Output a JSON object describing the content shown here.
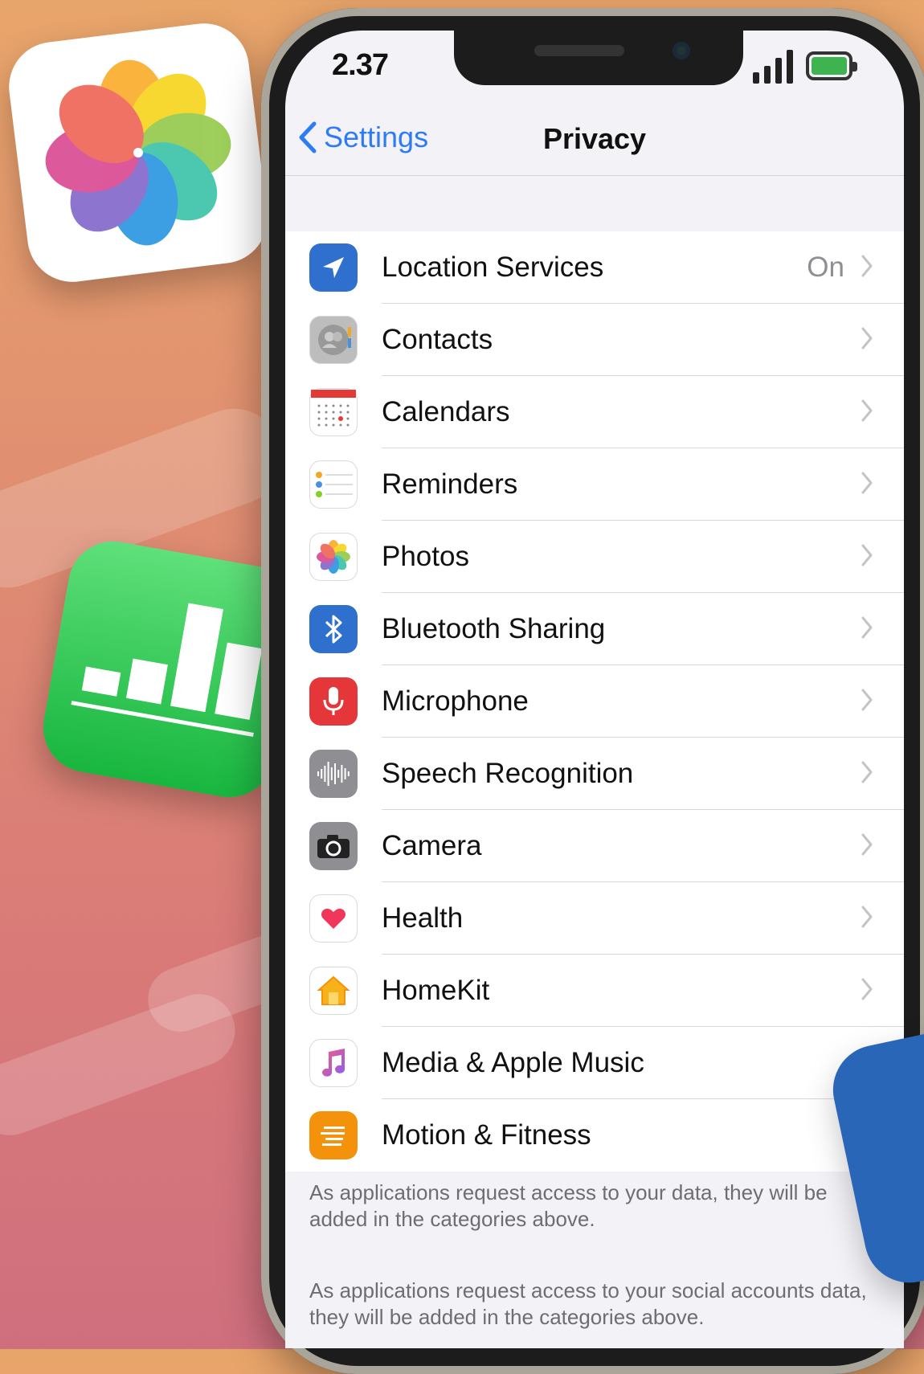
{
  "status_bar": {
    "time": "2.37"
  },
  "nav": {
    "back_label": "Settings",
    "title": "Privacy"
  },
  "rows": [
    {
      "label": "Location Services",
      "value": "On",
      "icon": "location-arrow-icon",
      "color": "#2f6fce"
    },
    {
      "label": "Contacts",
      "value": "",
      "icon": "contacts-icon",
      "color": "#bdbdbd"
    },
    {
      "label": "Calendars",
      "value": "",
      "icon": "calendar-icon",
      "color": "#ffffff"
    },
    {
      "label": "Reminders",
      "value": "",
      "icon": "reminders-icon",
      "color": "#ffffff"
    },
    {
      "label": "Photos",
      "value": "",
      "icon": "photos-icon",
      "color": "#ffffff"
    },
    {
      "label": "Bluetooth Sharing",
      "value": "",
      "icon": "bluetooth-icon",
      "color": "#2f6fce"
    },
    {
      "label": "Microphone",
      "value": "",
      "icon": "microphone-icon",
      "color": "#e5373a"
    },
    {
      "label": "Speech Recognition",
      "value": "",
      "icon": "waveform-icon",
      "color": "#8e8e93"
    },
    {
      "label": "Camera",
      "value": "",
      "icon": "camera-icon",
      "color": "#8e8e93"
    },
    {
      "label": "Health",
      "value": "",
      "icon": "heart-icon",
      "color": "#ffffff"
    },
    {
      "label": "HomeKit",
      "value": "",
      "icon": "home-icon",
      "color": "#ffffff"
    },
    {
      "label": "Media & Apple Music",
      "value": "",
      "icon": "music-note-icon",
      "color": "#ffffff"
    },
    {
      "label": "Motion & Fitness",
      "value": "",
      "icon": "motion-icon",
      "color": "#f5920b"
    }
  ],
  "footer": {
    "note1": "As applications request access to your data, they will be added in the categories above.",
    "note2": "As applications request access to your social accounts data, they will be added in the categories above."
  }
}
